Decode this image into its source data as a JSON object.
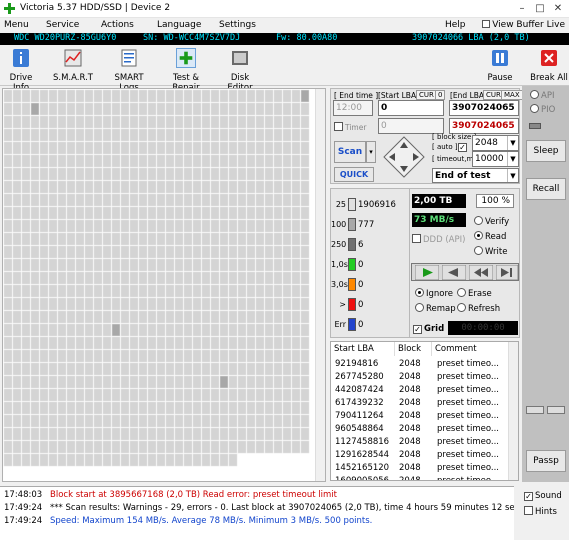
{
  "window": {
    "title": "Victoria 5.37 HDD/SSD | Device 2",
    "min": "–",
    "max": "□",
    "close": "✕"
  },
  "menu": {
    "items": [
      "Menu",
      "Service",
      "Actions",
      "Language",
      "Settings",
      "Help"
    ],
    "view_buffer": "View Buffer Live"
  },
  "drive": {
    "model": "WDC WD20PURZ-85GU6Y0",
    "serial": "SN: WD-WCC4M7SZV7DJ",
    "fw": "Fw: 80.00A80",
    "lba": "3907024066 LBA (2,0 TB)"
  },
  "toolbar": {
    "items": [
      {
        "label": "Drive Info"
      },
      {
        "label": "S.M.A.R.T"
      },
      {
        "label": "SMART Logs"
      },
      {
        "label": "Test & Repair"
      },
      {
        "label": "Disk Editor"
      }
    ],
    "pause": "Pause",
    "break_all": "Break All"
  },
  "scan": {
    "end_time_label": "[ End time ]",
    "end_time_value": "12:00",
    "start_lba_label": "[Start LBA]",
    "cur_label": "CUR",
    "zero_label": "0",
    "start_lba_value": "0",
    "start_lba_cur": "0",
    "end_lba_label": "[End LBA]",
    "end_cur_label": "CUR",
    "max_label": "MAX",
    "end_lba_value": "3907024065",
    "end_lba_cur": "3907024065",
    "timer_label": "Timer",
    "timer_value": "0",
    "block_size_label": "[ block size ]",
    "auto_label": "[ auto ]",
    "block_size": "2048",
    "timeout_label": "[ timeout,ms ]",
    "timeout": "10000",
    "scan_button": "Scan",
    "quick_button": "QUICK",
    "end_of_test": "End of test"
  },
  "stats": {
    "capacity": "2,00 TB",
    "percent": "100",
    "percent_unit": "%",
    "speed": "73 MB/s",
    "ddd": "DDD (API)",
    "verify": "Verify",
    "read": "Read",
    "write": "Write",
    "ignore": "Ignore",
    "erase": "Erase",
    "remap": "Remap",
    "refresh": "Refresh",
    "grid": "Grid",
    "timer_display": "00:00:00"
  },
  "legend": [
    {
      "ms": "25",
      "count": "1906916",
      "color": "#e0e0e0"
    },
    {
      "ms": "100",
      "count": "777",
      "color": "#a8a8a8"
    },
    {
      "ms": "250",
      "count": "6",
      "color": "#707070"
    },
    {
      "ms": "1,0s",
      "count": "0",
      "color": "#22cc22"
    },
    {
      "ms": "3,0s",
      "count": "0",
      "color": "#ff8800"
    },
    {
      "ms": ">",
      "count": "0",
      "color": "#ee1111"
    },
    {
      "ms": "Err",
      "count": "0",
      "color": "#2244cc"
    }
  ],
  "table": {
    "headers": [
      "Start LBA",
      "Block",
      "Comment"
    ],
    "rows": [
      [
        "92194816",
        "2048",
        "preset timeo..."
      ],
      [
        "267745280",
        "2048",
        "preset timeo..."
      ],
      [
        "442087424",
        "2048",
        "preset timeo..."
      ],
      [
        "617439232",
        "2048",
        "preset timeo..."
      ],
      [
        "790411264",
        "2048",
        "preset timeo..."
      ],
      [
        "960548864",
        "2048",
        "preset timeo..."
      ],
      [
        "1127458816",
        "2048",
        "preset timeo..."
      ],
      [
        "1291628544",
        "2048",
        "preset timeo..."
      ],
      [
        "1452165120",
        "2048",
        "preset timeo..."
      ],
      [
        "1609005056",
        "2048",
        "preset timeo..."
      ]
    ]
  },
  "right": {
    "api": "API",
    "pio": "PIO",
    "sleep": "Sleep",
    "recall": "Recall",
    "passp": "Passp"
  },
  "log": [
    {
      "time": "17:48:03",
      "msg": "Block start at 3895667168 (2,0 TB) Read error: preset timeout limit",
      "color": "#cc0000"
    },
    {
      "time": "17:49:24",
      "msg": "*** Scan results: Warnings - 29, errors - 0. Last block at 3907024065 (2,0 TB), time 4 hours 59 minutes 12 seconds.",
      "color": "#000000"
    },
    {
      "time": "17:49:24",
      "msg": "Speed: Maximum 154 MB/s. Average 78 MB/s. Minimum 3 MB/s. 500 points.",
      "color": "#1144cc"
    }
  ],
  "log_side": {
    "sound": "Sound",
    "hints": "Hints"
  }
}
